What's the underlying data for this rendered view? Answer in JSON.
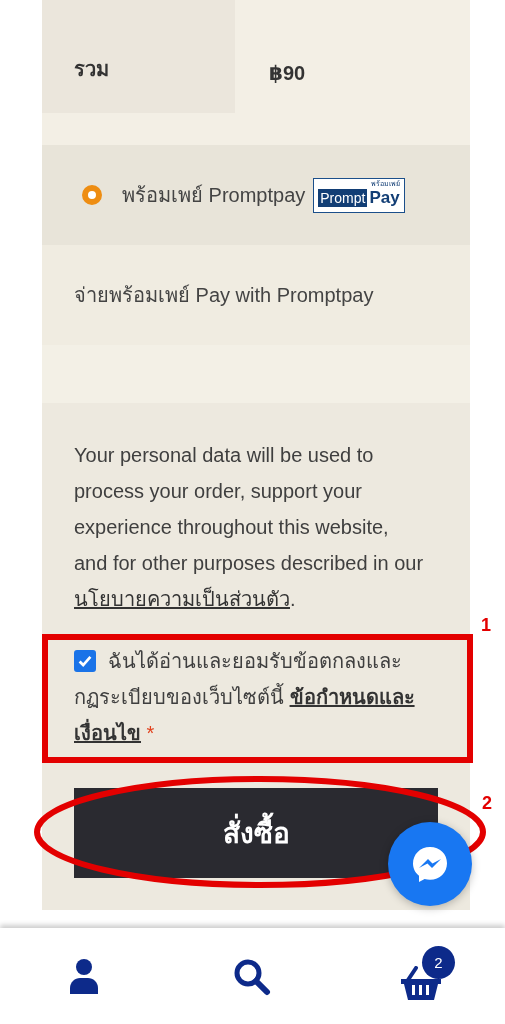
{
  "order_total": {
    "label": "รวม",
    "value": "฿90"
  },
  "payment_methods": [
    {
      "label": "พร้อมเพย์ Promptpay",
      "selected": true,
      "logo": {
        "main": "Prompt",
        "accent": "Pay",
        "small": "พร้อมเพย์"
      }
    }
  ],
  "payment_description": "จ่ายพร้อมเพย์ Pay with Promptpay",
  "privacy_notice": {
    "text": "Your personal data will be used to process your order, support your experience throughout this website, and for other purposes described in our ",
    "link": "นโยบายความเป็นส่วนตัว",
    "end": "."
  },
  "terms": {
    "checked": true,
    "text": "ฉันได้อ่านและยอมรับข้อตกลงและกฏระเบียบของเว็บไซต์นี้ ",
    "link": "ข้อกำหนดและเงื่อนไข",
    "required_mark": "*"
  },
  "place_order_button": "สั่งซื้อ",
  "annotations": [
    {
      "number": "1",
      "kind": "box"
    },
    {
      "number": "2",
      "kind": "ellipse"
    }
  ],
  "bottom_nav": [
    {
      "kind": "account"
    },
    {
      "kind": "search"
    },
    {
      "kind": "cart",
      "badge": "2"
    }
  ]
}
